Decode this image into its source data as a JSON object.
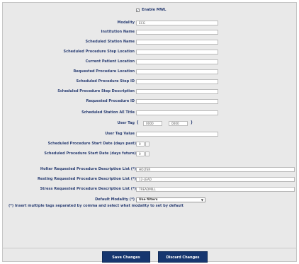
{
  "mwl": {
    "enable_label": "Enable MWL",
    "enable_checked": true,
    "check_glyph": "✓"
  },
  "fields": {
    "modality": {
      "label": "Modality",
      "value": "ECG"
    },
    "institution_name": {
      "label": "Institution Name",
      "value": ""
    },
    "scheduled_station_name": {
      "label": "Scheduled Station Name",
      "value": ""
    },
    "sps_location": {
      "label": "Scheduled Procedure Step Location",
      "value": ""
    },
    "current_patient_location": {
      "label": "Current Patient Location",
      "value": ""
    },
    "requested_procedure_location": {
      "label": "Requested Procedure Location",
      "value": ""
    },
    "sps_id": {
      "label": "Scheduled Procedure Step ID",
      "value": ""
    },
    "sps_description": {
      "label": "Scheduled Procedure Step Description",
      "value": ""
    },
    "requested_procedure_id": {
      "label": "Requested Procedure ID",
      "value": ""
    },
    "scheduled_station_ae_title": {
      "label": "Scheduled Station AE Title",
      "value": ""
    },
    "user_tag": {
      "label": "User Tag",
      "open_paren": "(",
      "close_paren": ")",
      "group": "0000",
      "element": "0000"
    },
    "user_tag_value": {
      "label": "User Tag Value",
      "value": ""
    },
    "start_date_past": {
      "label": "Scheduled Procedure Start Date (days past)",
      "value": "0"
    },
    "start_date_future": {
      "label": "Scheduled Procedure Start Date (days future)",
      "value": "0"
    }
  },
  "descriptions": {
    "holter": {
      "label": "Holter Requested Procedure Description List (*)",
      "value": "HOLTER"
    },
    "resting": {
      "label": "Resting Requested Procedure Description List (*)",
      "value": "12-LEAD"
    },
    "stress": {
      "label": "Stress Requested Procedure Description List (*)",
      "value": "TREADMILL"
    }
  },
  "default_modality": {
    "label": "Default Modality (*)",
    "selected": "Use filters",
    "arrow": "▼"
  },
  "note": "(*) Insert multiple tags separated by comma and select what modality to set by default",
  "buttons": {
    "save": "Save Changes",
    "discard": "Discard Changes"
  }
}
